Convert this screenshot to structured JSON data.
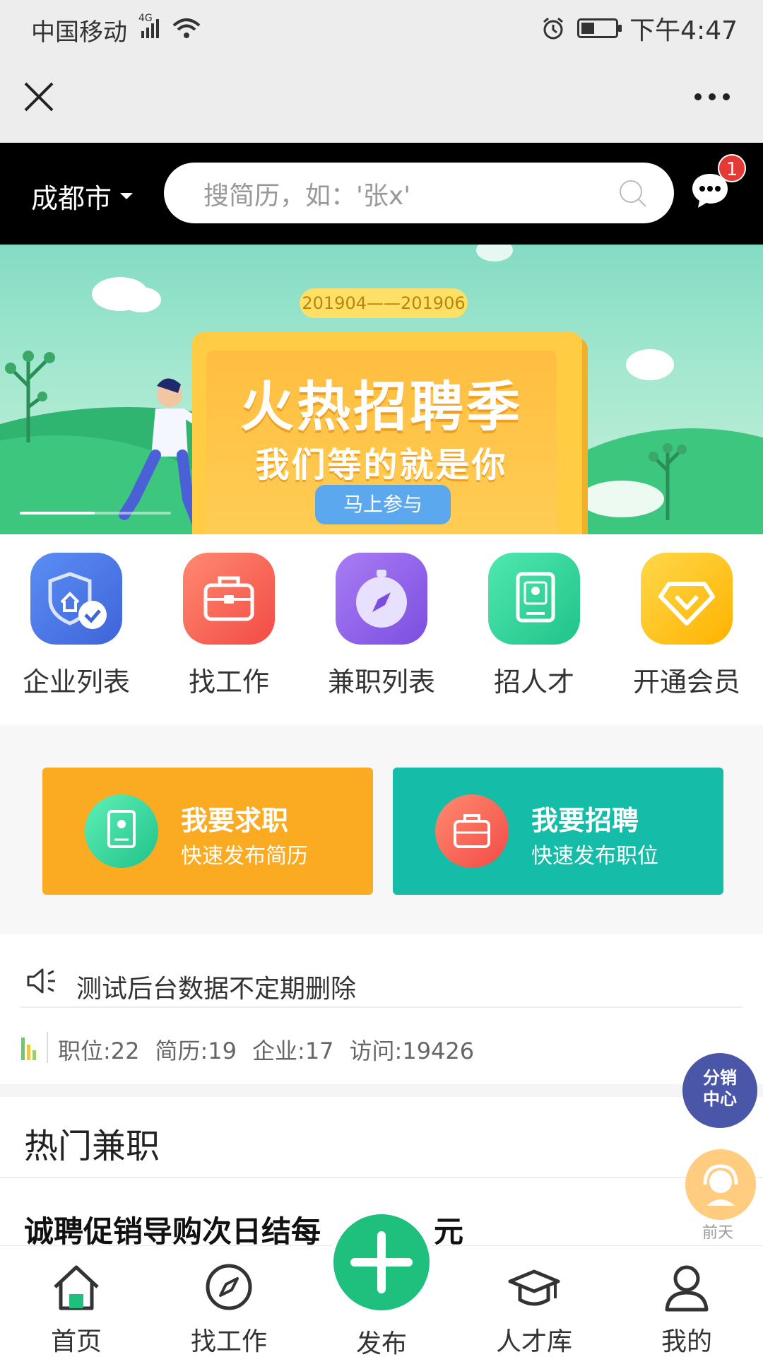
{
  "status": {
    "carrier": "中国移动",
    "network": "4G",
    "time": "下午4:47"
  },
  "header": {
    "city": "成都市",
    "search_placeholder": "搜简历，如：'张x'",
    "message_count": "1"
  },
  "banner": {
    "date_range": "201904——201906",
    "title": "火热招聘季",
    "subtitle": "我们等的就是你",
    "button": "马上参与"
  },
  "quick": [
    {
      "label": "企业列表",
      "icon": "shield-company-icon",
      "color": "#4f79e8"
    },
    {
      "label": "找工作",
      "icon": "briefcase-icon",
      "color": "#f4574c"
    },
    {
      "label": "兼职列表",
      "icon": "compass-icon",
      "color": "#8d63e8"
    },
    {
      "label": "招人才",
      "icon": "resume-icon",
      "color": "#2fd59c"
    },
    {
      "label": "开通会员",
      "icon": "diamond-icon",
      "color": "#ffc526"
    }
  ],
  "actions": {
    "seek": {
      "title": "我要求职",
      "subtitle": "快速发布简历",
      "color": "#fbab22"
    },
    "hire": {
      "title": "我要招聘",
      "subtitle": "快速发布职位",
      "color": "#15bca8"
    }
  },
  "notice": {
    "text": "测试后台数据不定期删除"
  },
  "stats": [
    "职位:22",
    "简历:19",
    "企业:17",
    "访问:19426"
  ],
  "hot": {
    "title": "热门兼职",
    "first_job": "诚聘促销导购次日结每",
    "first_job_tail": "元"
  },
  "floating": {
    "distribution": [
      "分销",
      "中心"
    ],
    "service_label": "前天"
  },
  "tabs": {
    "home": "首页",
    "jobs": "找工作",
    "publish": "发布",
    "talent": "人才库",
    "mine": "我的"
  }
}
